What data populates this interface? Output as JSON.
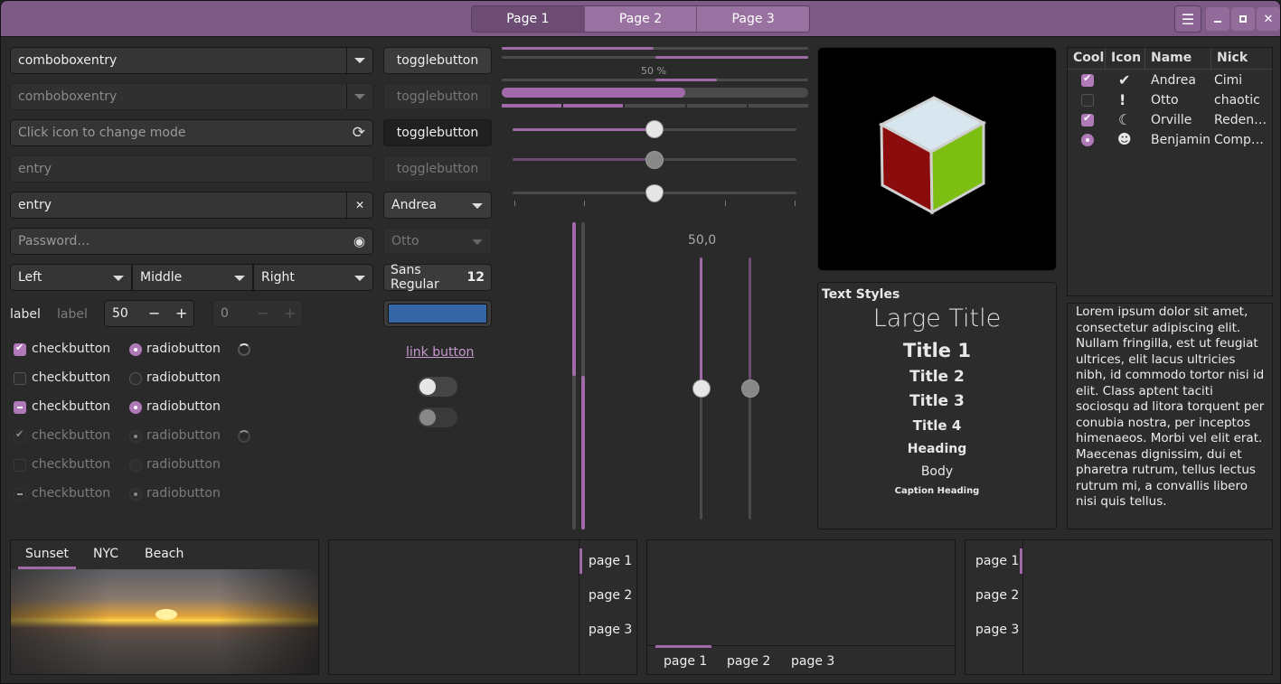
{
  "window": {
    "tabs": [
      "Page 1",
      "Page 2",
      "Page 3"
    ],
    "menu_icon": "hamburger-icon",
    "min_icon": "minimize-icon",
    "max_icon": "maximize-icon",
    "close_icon": "close-icon",
    "accent": "#a06aa8"
  },
  "left": {
    "combo1": "comboboxentry",
    "combo2": "comboboxentry",
    "mode_placeholder": "Click icon to change mode",
    "entry1": "entry",
    "entry2": "entry",
    "password_placeholder": "Password…",
    "combo_left": "Left",
    "combo_middle": "Middle",
    "combo_right": "Right",
    "label1": "label",
    "label2": "label",
    "spin1": "50",
    "spin2": "0",
    "checkbuttons": [
      "checkbutton",
      "checkbutton",
      "checkbutton",
      "checkbutton",
      "checkbutton",
      "checkbutton"
    ],
    "radiobuttons": [
      "radiobutton",
      "radiobutton",
      "radiobutton",
      "radiobutton",
      "radiobutton",
      "radiobutton"
    ]
  },
  "mid": {
    "toggles": [
      "togglebutton",
      "togglebutton",
      "togglebutton",
      "togglebutton"
    ],
    "combo_andrea": "Andrea",
    "combo_otto": "Otto",
    "font_name": "Sans Regular",
    "font_size": "12",
    "color_swatch": "#3465a4",
    "link": "link button",
    "progress_label": "50 %",
    "progress_value": 0.5,
    "scale_value": "50,0"
  },
  "textstyles": {
    "heading": "Text Styles",
    "large": "Large Title",
    "t1": "Title 1",
    "t2": "Title 2",
    "t3": "Title 3",
    "t4": "Title 4",
    "h": "Heading",
    "body": "Body",
    "caption": "Caption Heading"
  },
  "tree": {
    "columns": [
      "Cool",
      "Icon",
      "Name",
      "Nick"
    ],
    "rows": [
      {
        "cool": true,
        "icon": "check-circle-icon",
        "name": "Andrea",
        "nick": "Cimi"
      },
      {
        "cool": false,
        "icon": "alert-circle-icon",
        "name": "Otto",
        "nick": "chaotic"
      },
      {
        "cool": true,
        "icon": "moon-icon",
        "name": "Orville",
        "nick": "Reden…"
      },
      {
        "cool": "radio",
        "icon": "robot-icon",
        "name": "Benjamin",
        "nick": "Comp…"
      }
    ]
  },
  "lorem": "Lorem ipsum dolor sit amet, consectetur adipiscing elit. Nullam fringilla, est ut feugiat ultrices, elit lacus ultricies nibh, id commodo tortor nisi id elit. Class aptent taciti sociosqu ad litora torquent per conubia nostra, per inceptos himenaeos. Morbi vel elit erat. Maecenas dignissim, dui et pharetra rutrum, tellus lectus rutrum mi, a convallis libero nisi quis tellus.",
  "bottom": {
    "img_tabs": [
      "Sunset",
      "NYC",
      "Beach"
    ],
    "pages": [
      "page 1",
      "page 2",
      "page 3"
    ]
  }
}
